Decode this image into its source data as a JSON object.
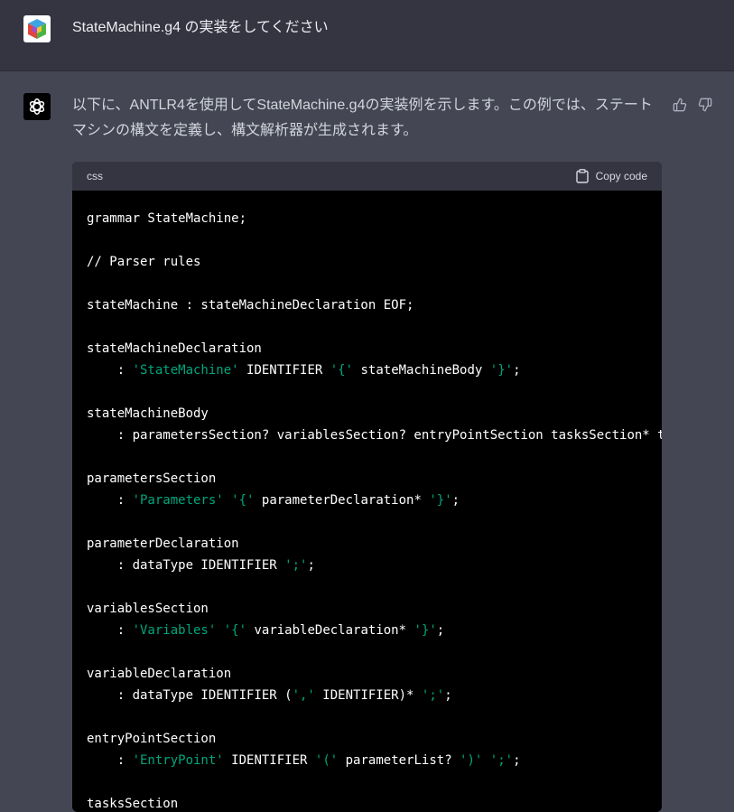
{
  "user_message": {
    "text": "StateMachine.g4 の実装をしてください"
  },
  "assistant_message": {
    "text": "以下に、ANTLR4を使用してStateMachine.g4の実装例を示します。この例では、ステートマシンの構文を定義し、構文解析器が生成されます。",
    "feedback": {
      "thumbs_up_icon": "thumbs-up-icon",
      "thumbs_down_icon": "thumbs-down-icon"
    },
    "code_block": {
      "language": "css",
      "copy_label": "Copy code",
      "lines": [
        [
          {
            "t": "grammar StateMachine;"
          }
        ],
        [],
        [
          {
            "t": "// Parser rules"
          }
        ],
        [],
        [
          {
            "t": "stateMachine : stateMachineDeclaration EOF;"
          }
        ],
        [],
        [
          {
            "t": "stateMachineDeclaration"
          }
        ],
        [
          {
            "t": "    : "
          },
          {
            "t": "'StateMachine'",
            "s": true
          },
          {
            "t": " IDENTIFIER "
          },
          {
            "t": "'{'",
            "s": true
          },
          {
            "t": " stateMachineBody "
          },
          {
            "t": "'}'",
            "s": true
          },
          {
            "t": ";"
          }
        ],
        [],
        [
          {
            "t": "stateMachineBody"
          }
        ],
        [
          {
            "t": "    : parametersSection? variablesSection? entryPointSection tasksSection* t"
          }
        ],
        [],
        [
          {
            "t": "parametersSection"
          }
        ],
        [
          {
            "t": "    : "
          },
          {
            "t": "'Parameters'",
            "s": true
          },
          {
            "t": " "
          },
          {
            "t": "'{'",
            "s": true
          },
          {
            "t": " parameterDeclaration* "
          },
          {
            "t": "'}'",
            "s": true
          },
          {
            "t": ";"
          }
        ],
        [],
        [
          {
            "t": "parameterDeclaration"
          }
        ],
        [
          {
            "t": "    : dataType IDENTIFIER "
          },
          {
            "t": "';'",
            "s": true
          },
          {
            "t": ";"
          }
        ],
        [],
        [
          {
            "t": "variablesSection"
          }
        ],
        [
          {
            "t": "    : "
          },
          {
            "t": "'Variables'",
            "s": true
          },
          {
            "t": " "
          },
          {
            "t": "'{'",
            "s": true
          },
          {
            "t": " variableDeclaration* "
          },
          {
            "t": "'}'",
            "s": true
          },
          {
            "t": ";"
          }
        ],
        [],
        [
          {
            "t": "variableDeclaration"
          }
        ],
        [
          {
            "t": "    : dataType IDENTIFIER ("
          },
          {
            "t": "','",
            "s": true
          },
          {
            "t": " IDENTIFIER)* "
          },
          {
            "t": "';'",
            "s": true
          },
          {
            "t": ";"
          }
        ],
        [],
        [
          {
            "t": "entryPointSection"
          }
        ],
        [
          {
            "t": "    : "
          },
          {
            "t": "'EntryPoint'",
            "s": true
          },
          {
            "t": " IDENTIFIER "
          },
          {
            "t": "'('",
            "s": true
          },
          {
            "t": " parameterList? "
          },
          {
            "t": "')'",
            "s": true
          },
          {
            "t": " "
          },
          {
            "t": "';'",
            "s": true
          },
          {
            "t": ";"
          }
        ],
        [],
        [
          {
            "t": "tasksSection"
          }
        ]
      ]
    }
  },
  "colors": {
    "user_bg": "#343541",
    "assistant_bg": "#444654",
    "code_bg": "#000000",
    "code_header_bg": "#343541",
    "string_color": "#00a67d"
  }
}
